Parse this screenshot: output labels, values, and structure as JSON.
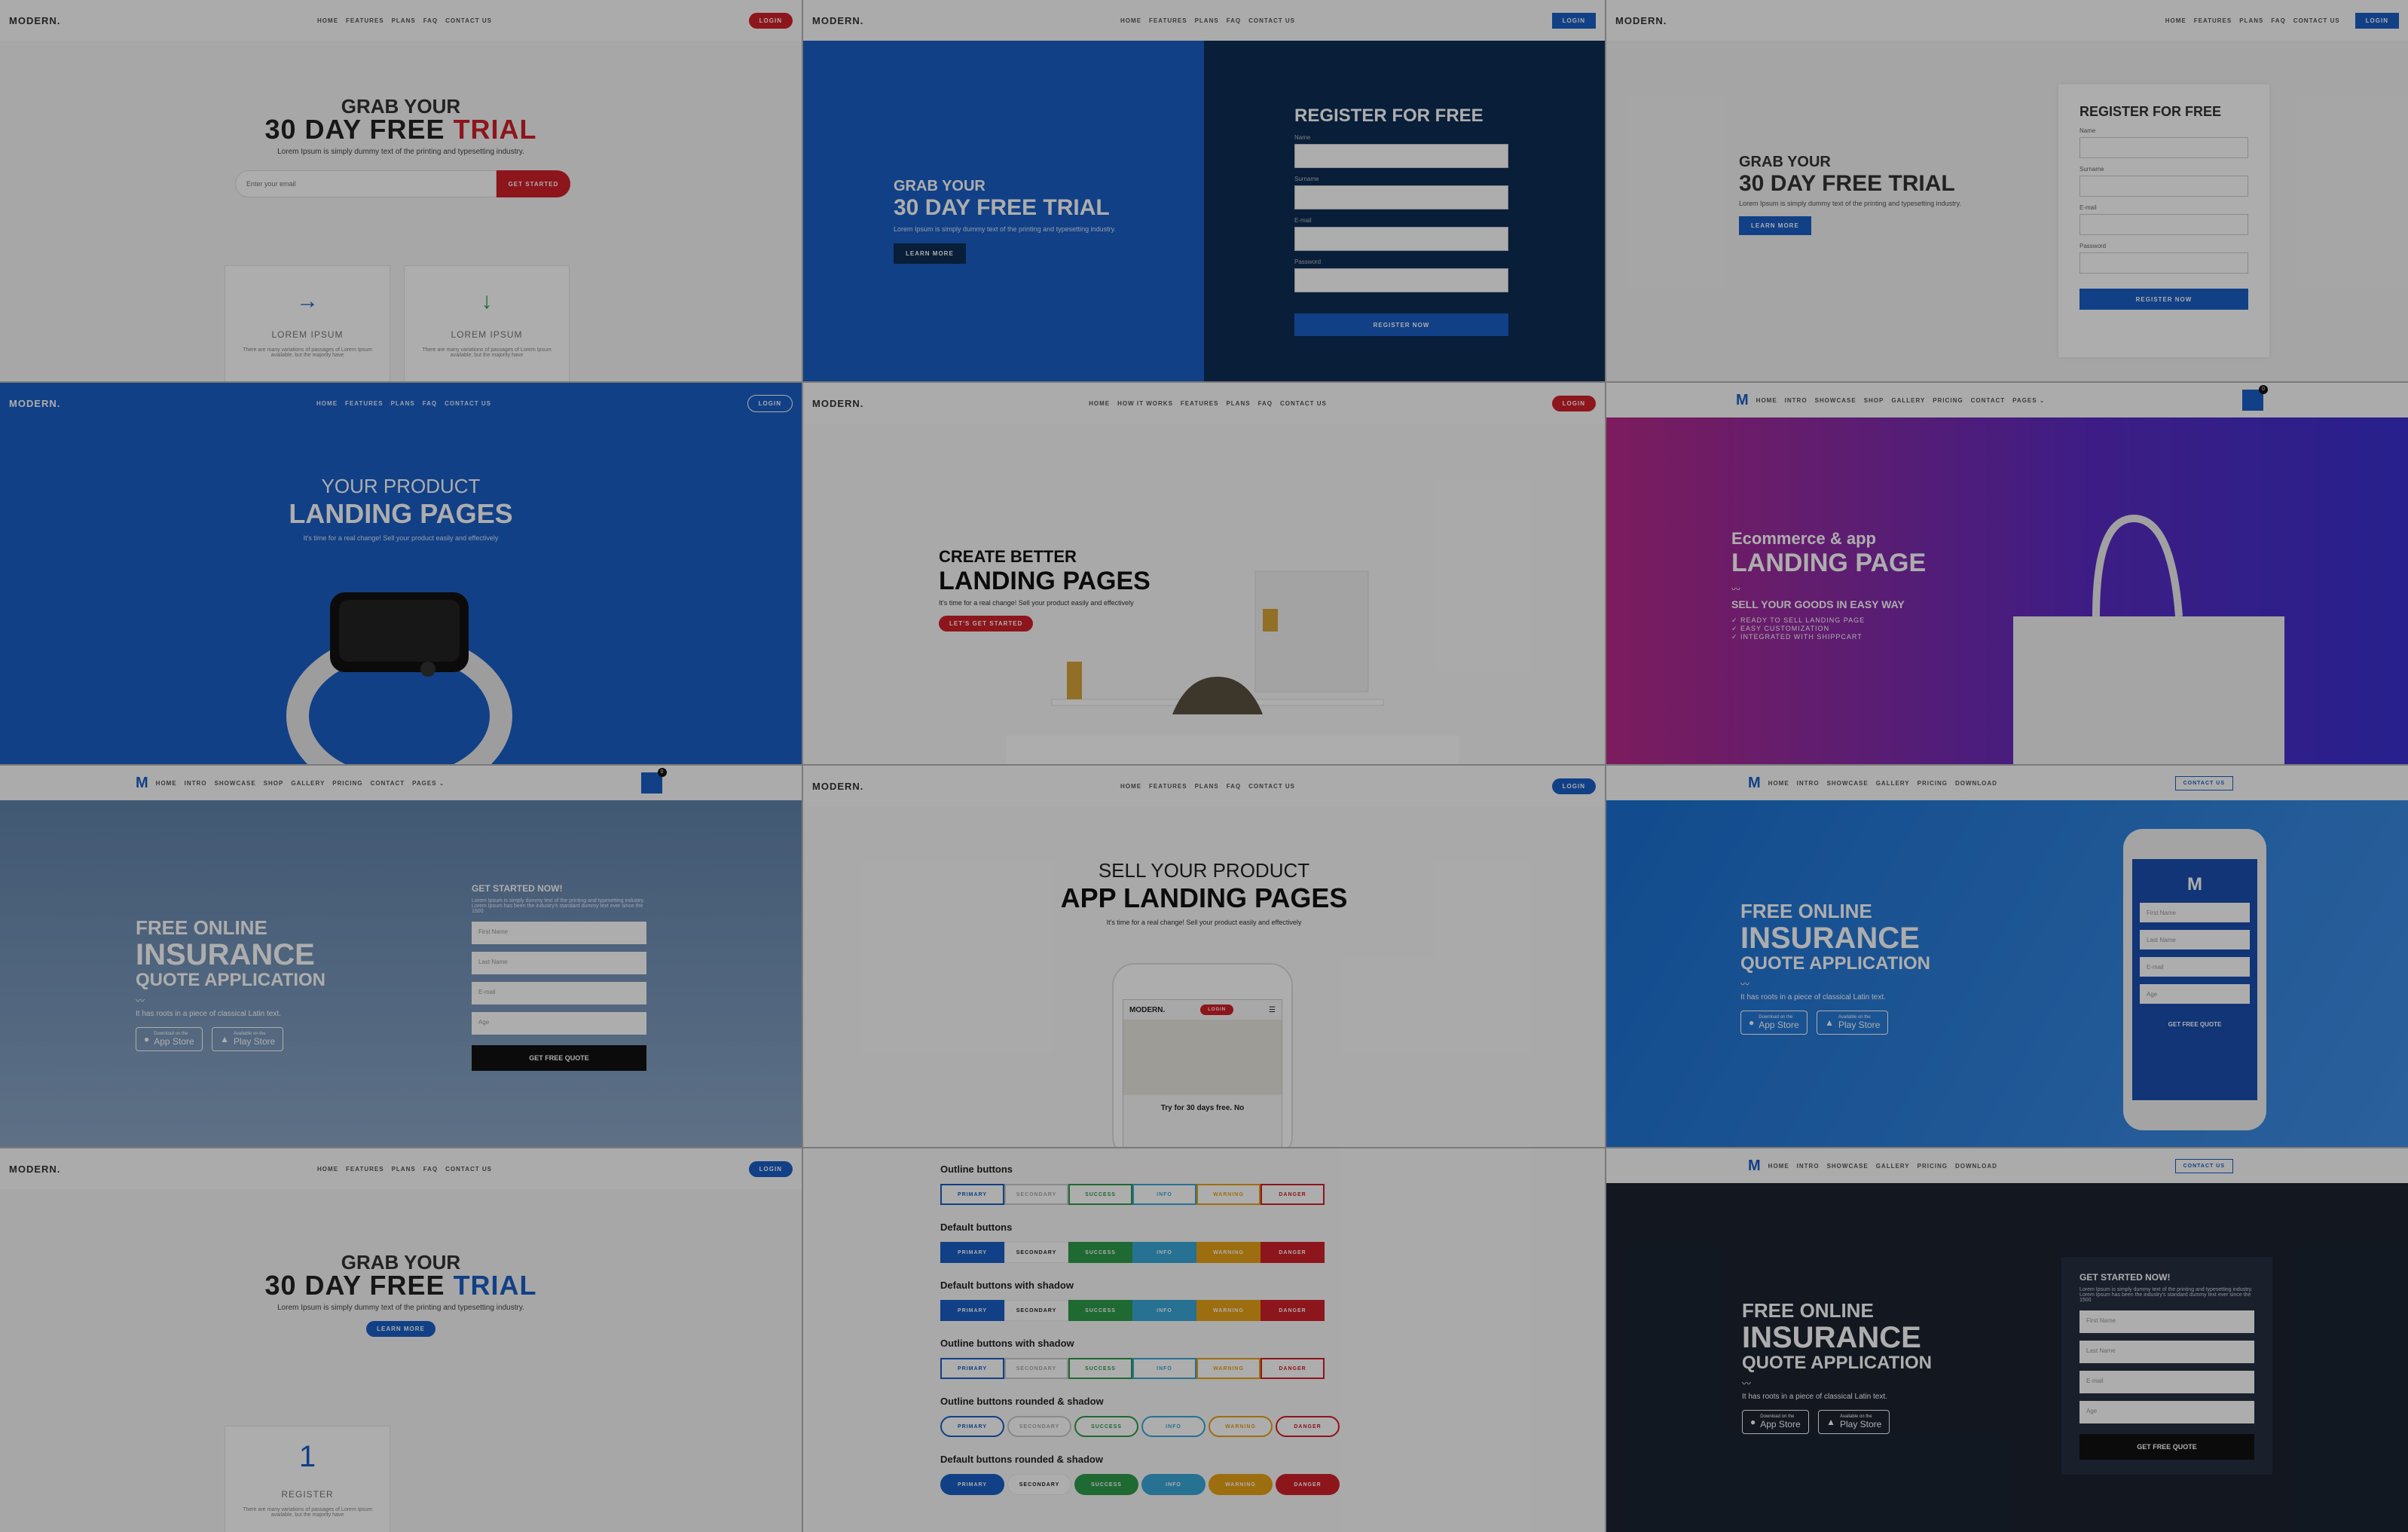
{
  "brand": "MODERN.",
  "menu_basic": [
    "HOME",
    "FEATURES",
    "PLANS",
    "FAQ",
    "CONTACT US"
  ],
  "menu_howitworks": [
    "HOME",
    "HOW IT WORKS",
    "FEATURES",
    "PLANS",
    "FAQ",
    "CONTACT US"
  ],
  "menu_shop": [
    "HOME",
    "INTRO",
    "SHOWCASE",
    "SHOP",
    "GALLERY",
    "PRICING",
    "CONTACT",
    "PAGES ⌄"
  ],
  "menu_app": [
    "HOME",
    "INTRO",
    "SHOWCASE",
    "GALLERY",
    "PRICING",
    "DOWNLOAD"
  ],
  "login": "LOGIN",
  "contact_us": "CONTACT US",
  "t1": {
    "line1": "GRAB YOUR",
    "line2a": "30 DAY FREE ",
    "line2b": "TRIAL",
    "sub": "Lorem Ipsum is simply dummy text of the printing and typesetting industry.",
    "placeholder": "Enter your email",
    "cta": "GET STARTED",
    "card1": "LOREM IPSUM",
    "card2": "LOREM IPSUM",
    "card_desc": "There are many variations of passages of Lorem Ipsum available, but the majority have"
  },
  "t2": {
    "line1": "GRAB YOUR",
    "line2": "30 DAY FREE TRIAL",
    "sub": "Lorem Ipsum is simply dummy text of the printing and typesetting industry.",
    "cta": "LEARN MORE",
    "form_title": "REGISTER FOR FREE",
    "labels": [
      "Name",
      "Surname",
      "E-mail",
      "Password"
    ],
    "submit": "REGISTER NOW"
  },
  "t3": {
    "line1": "GRAB YOUR",
    "line2": "30 DAY FREE TRIAL",
    "sub": "Lorem Ipsum is simply dummy text of the printing and typesetting industry.",
    "cta": "LEARN MORE",
    "form_title": "REGISTER FOR FREE",
    "labels": [
      "Name",
      "Surname",
      "E-mail",
      "Password"
    ],
    "submit": "REGISTER NOW"
  },
  "t4": {
    "line1": "YOUR PRODUCT",
    "line2": "LANDING PAGES",
    "sub": "It's time for a real change! Sell your product easily and effectively"
  },
  "t5": {
    "line1": "CREATE BETTER",
    "line2": "LANDING PAGES",
    "sub": "It's time for a real change! Sell your product easily and effectively",
    "cta": "LET'S GET STARTED"
  },
  "t6": {
    "cart_count": "0",
    "line1": "Ecommerce & app",
    "line2": "LANDING PAGE",
    "sub": "SELL YOUR GOODS IN EASY WAY",
    "bullets": [
      "READY TO SELL LANDING PAGE",
      "EASY CUSTOMIZATION",
      "INTEGRATED WITH SHIPPCART"
    ]
  },
  "t7": {
    "cart_count": "0",
    "line1": "FREE ONLINE",
    "line2": "INSURANCE",
    "line3": "QUOTE APPLICATION",
    "sub": "It has roots in a piece of classical Latin text.",
    "app_store_small": "Download on the",
    "app_store": "App Store",
    "play_store_small": "Available on the",
    "play_store": "Play Store",
    "form_title": "GET STARTED NOW!",
    "form_desc": "Lorem Ipsum is simply dummy text of the printing and typesetting industry. Lorem Ipsum has been the industry's standard dummy text ever since the 1500",
    "fields": [
      "First Name",
      "Last Name",
      "E-mail",
      "Age"
    ],
    "submit": "GET FREE QUOTE"
  },
  "t8": {
    "line1": "SELL YOUR PRODUCT",
    "line2": "APP LANDING PAGES",
    "sub": "It's time for a real change! Sell your product easily and effectively",
    "phone_brand": "MODERN.",
    "phone_login": "LOGIN",
    "phone_text": "Try for 30 days free. No"
  },
  "t9": {
    "line1": "FREE ONLINE",
    "line2": "INSURANCE",
    "line3": "QUOTE APPLICATION",
    "sub": "It has roots in a piece of classical Latin text.",
    "app_store_small": "Download on the",
    "app_store": "App Store",
    "play_store_small": "Available on the",
    "play_store": "Play Store",
    "fields": [
      "First Name",
      "Last Name",
      "E-mail",
      "Age"
    ],
    "submit": "GET FREE QUOTE"
  },
  "t10": {
    "line1": "GRAB YOUR",
    "line2a": "30 DAY FREE ",
    "line2b": "TRIAL",
    "sub": "Lorem Ipsum is simply dummy text of the printing and typesetting industry.",
    "cta": "LEARN MORE",
    "card_number": "1",
    "card_title": "REGISTER",
    "card_desc": "There are many variations of passages of Lorem Ipsum available, but the majority have"
  },
  "t11": {
    "sections": [
      {
        "title": "Outline buttons",
        "style": "outline"
      },
      {
        "title": "Default buttons",
        "style": "default"
      },
      {
        "title": "Default buttons with shadow",
        "style": "default"
      },
      {
        "title": "Outline buttons with shadow",
        "style": "outline"
      },
      {
        "title": "Outline buttons rounded & shadow",
        "style": "outline-round"
      },
      {
        "title": "Default buttons rounded & shadow",
        "style": "default-round"
      }
    ],
    "buttons": [
      "PRIMARY",
      "SECONDARY",
      "SUCCESS",
      "INFO",
      "WARNING",
      "DANGER"
    ],
    "colors": [
      "#1a5fc6",
      "#ffffff",
      "#2e9b4a",
      "#3aa7d9",
      "#e8a317",
      "#d0202a"
    ]
  },
  "t12": {
    "line1": "FREE ONLINE",
    "line2": "INSURANCE",
    "line3": "QUOTE APPLICATION",
    "sub": "It has roots in a piece of classical Latin text.",
    "app_store_small": "Download on the",
    "app_store": "App Store",
    "play_store_small": "Available on the",
    "play_store": "Play Store",
    "form_title": "GET STARTED NOW!",
    "form_desc": "Lorem Ipsum is simply dummy text of the printing and typesetting industry. Lorem Ipsum has been the industry's standard dummy text ever since the 1500",
    "fields": [
      "First Name",
      "Last Name",
      "E-mail",
      "Age"
    ],
    "submit": "GET FREE QUOTE"
  },
  "colors": {
    "red": "#d0202a",
    "blue": "#1a5fc6",
    "navy": "#0d2d54",
    "dark": "#1b2330"
  }
}
